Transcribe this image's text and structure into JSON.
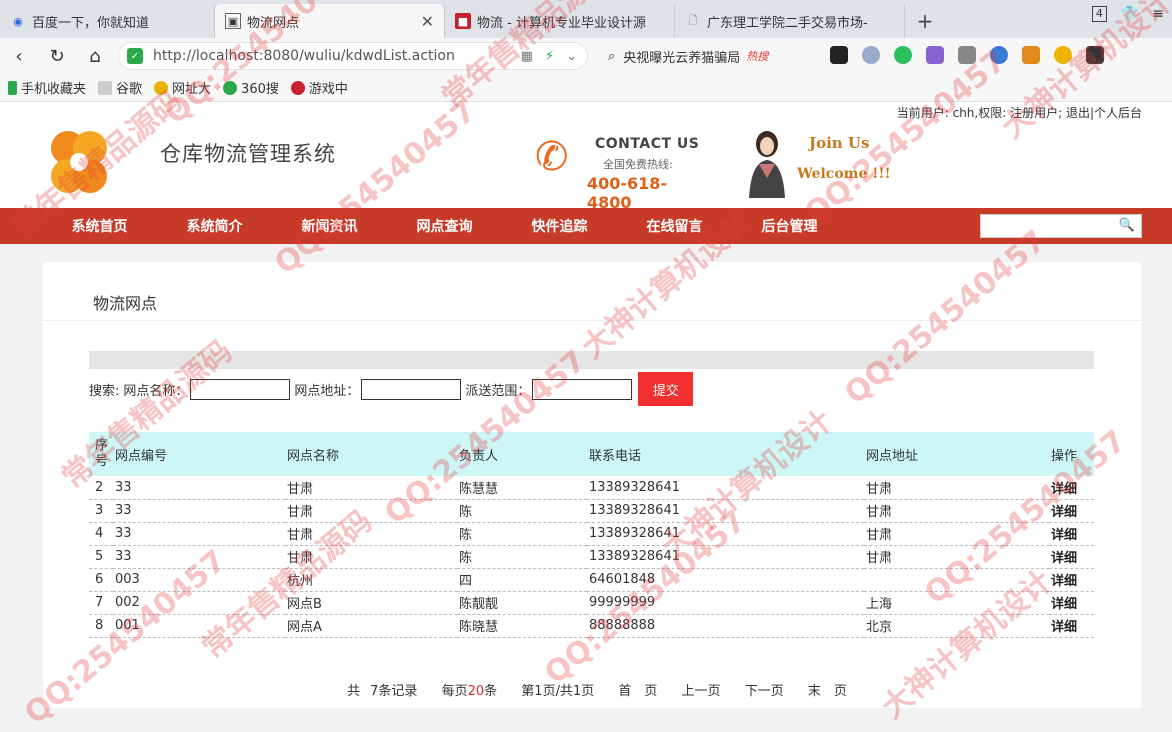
{
  "browser": {
    "tabs": [
      {
        "label": "百度一下，你就知道",
        "color": "#2b65e8"
      },
      {
        "label": "物流网点",
        "color": "#555555"
      },
      {
        "label": "物流 - 计算机专业毕业设计源",
        "color": "#c9202e"
      },
      {
        "label": "广东理工学院二手交易市场-",
        "color": "#777777"
      }
    ],
    "tab_badge": "4",
    "url": "http://localhost:8080/wuliu/kdwdList.action",
    "search_text": "央视曝光云养猫骗局",
    "search_hot": "热搜",
    "bookmarks": [
      "手机收藏夹",
      "谷歌",
      "网址大",
      "360搜",
      "游戏中"
    ]
  },
  "header": {
    "user_info": "当前用户: chh,权限: 注册用户; 退出|个人后台",
    "site_title": "仓库物流管理系统",
    "contact_title": "CONTACT US",
    "contact_free": "全国免费热线:",
    "contact_tel": "400-618-4800",
    "join1": "Join Us",
    "join2": "Welcome !!!"
  },
  "nav": [
    "系统首页",
    "系统简介",
    "新闻资讯",
    "网点查询",
    "快件追踪",
    "在线留言",
    "后台管理"
  ],
  "panel": {
    "title": "物流网点",
    "search": {
      "label_search": "搜索:",
      "label_name": "网点名称：",
      "label_addr": "网点地址：",
      "label_range": "派送范围：",
      "submit": "提交"
    },
    "columns": [
      "序号",
      "网点编号",
      "网点名称",
      "负责人",
      "联系电话",
      "网点地址",
      "操作"
    ],
    "rows": [
      [
        "2",
        "33",
        "甘肃",
        "陈慧慧",
        "13389328641",
        "甘肃",
        "详细"
      ],
      [
        "3",
        "33",
        "甘肃",
        "陈",
        "13389328641",
        "甘肃",
        "详细"
      ],
      [
        "4",
        "33",
        "甘肃",
        "陈",
        "13389328641",
        "甘肃",
        "详细"
      ],
      [
        "5",
        "33",
        "甘肃",
        "陈",
        "13389328641",
        "甘肃",
        "详细"
      ],
      [
        "6",
        "003",
        "杭州",
        "四",
        "64601848",
        "",
        "详细"
      ],
      [
        "7",
        "002",
        "网点B",
        "陈靓靓",
        "99999999",
        "上海",
        "详细"
      ],
      [
        "8",
        "001",
        "网点A",
        "陈晓慧",
        "88888888",
        "北京",
        "详细"
      ]
    ],
    "pager": {
      "total_pre": "共",
      "total": "7",
      "total_post": "条记录",
      "per_pre": "每页",
      "per": "20",
      "per_post": "条",
      "page_info": "第1页/共1页",
      "first": "首　页",
      "prev": "上一页",
      "next": "下一页",
      "last": "末　页"
    }
  },
  "watermark": {
    "qq": "QQ:254540457",
    "t1": "常年售精品源码",
    "t2": "大神计算机设计"
  }
}
